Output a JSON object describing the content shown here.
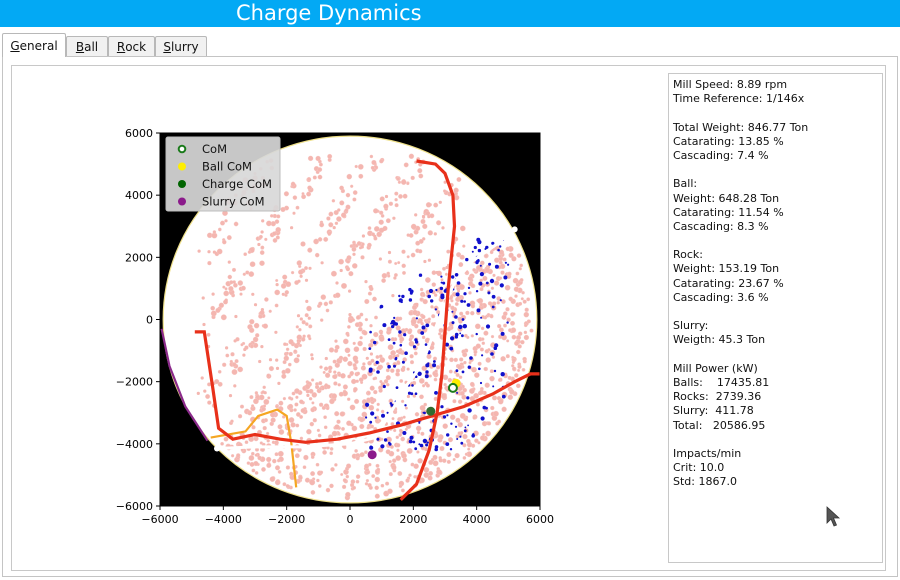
{
  "window": {
    "title": "Charge Dynamics"
  },
  "tabs": [
    {
      "label": "General",
      "accel": "G",
      "rest": "eneral",
      "active": true
    },
    {
      "label": "Ball",
      "accel": "B",
      "rest": "all",
      "active": false
    },
    {
      "label": "Rock",
      "accel": "R",
      "rest": "ock",
      "active": false
    },
    {
      "label": "Slurry",
      "accel": "S",
      "rest": "lurry",
      "active": false
    }
  ],
  "info": {
    "mill_speed": "Mill Speed: 8.89 rpm",
    "time_reference": "Time Reference: 1/146x",
    "total_weight": "Total Weight: 846.77 Ton",
    "total_catarating": "Catarating: 13.85 %",
    "total_cascading": "Cascading: 7.4 %",
    "ball_header": "Ball:",
    "ball_weight": "Weight: 648.28 Ton",
    "ball_catarating": "Catarating: 11.54 %",
    "ball_cascading": "Cascading: 8.3 %",
    "rock_header": "Rock:",
    "rock_weight": "Weight: 153.19 Ton",
    "rock_catarating": "Catarating: 23.67 %",
    "rock_cascading": "Cascading: 3.6 %",
    "slurry_header": "Slurry:",
    "slurry_weight": "Weigth: 45.3 Ton",
    "power_header": "Mill Power (kW)",
    "power_balls": "Balls:    17435.81",
    "power_rocks": "Rocks:  2739.36",
    "power_slurry": "Slurry:  411.78",
    "power_total": "Total:   20586.95",
    "impacts_header": "Impacts/min",
    "impacts_crit": "Crit: 10.0",
    "impacts_std": "Std: 1867.0"
  },
  "chart_data": {
    "type": "scatter",
    "xlim": [
      -6000,
      6000
    ],
    "ylim": [
      -6000,
      6000
    ],
    "xticks": [
      -6000,
      -4000,
      -2000,
      0,
      2000,
      4000,
      6000
    ],
    "yticks": [
      -6000,
      -4000,
      -2000,
      0,
      2000,
      4000,
      6000
    ],
    "xtick_labels": [
      "−6000",
      "−4000",
      "−2000",
      "0",
      "2000",
      "4000",
      "6000"
    ],
    "ytick_labels": [
      "−6000",
      "−4000",
      "−2000",
      "0",
      "2000",
      "4000",
      "6000"
    ],
    "legend_position": "top-left",
    "mill_radius": 5900,
    "legend": [
      {
        "label": "CoM",
        "color": "#1a7a1a",
        "marker": "ring"
      },
      {
        "label": "Ball CoM",
        "color": "#ffee00",
        "marker": "dot"
      },
      {
        "label": "Charge CoM",
        "color": "#006400",
        "marker": "dot"
      },
      {
        "label": "Slurry CoM",
        "color": "#8b1a8b",
        "marker": "dot"
      }
    ],
    "com_points": [
      {
        "name": "Ball CoM",
        "x": 3350,
        "y": -2050,
        "color": "#ffee00"
      },
      {
        "name": "CoM",
        "x": 3250,
        "y": -2200,
        "color": "#1a7a1a"
      },
      {
        "name": "Charge CoM",
        "x": 2550,
        "y": -2950,
        "color": "#2f6b2f"
      },
      {
        "name": "Slurry CoM",
        "x": 700,
        "y": -4350,
        "color": "#8b1a8b"
      }
    ],
    "colors": {
      "background": "#000000",
      "rock_particles": "#f4b6b0",
      "ball_particles": "#1010cc",
      "red_profile": "#e8301a",
      "white_profile": "#ffffff",
      "orange_profile": "#f5a623",
      "purple_profile": "#8b2a8b",
      "mill_shell": "#eee08a"
    },
    "red_profile_1": [
      [
        -4900,
        -400
      ],
      [
        -4600,
        -400
      ],
      [
        -4350,
        -2100
      ],
      [
        -4150,
        -3500
      ],
      [
        -3700,
        -3850
      ],
      [
        -3000,
        -3700
      ],
      [
        -2200,
        -3850
      ],
      [
        -1400,
        -3950
      ],
      [
        -400,
        -3850
      ],
      [
        600,
        -3650
      ],
      [
        1600,
        -3400
      ],
      [
        2600,
        -3100
      ],
      [
        3600,
        -2800
      ],
      [
        4500,
        -2400
      ],
      [
        5200,
        -2000
      ],
      [
        5700,
        -1750
      ],
      [
        6000,
        -1750
      ]
    ],
    "red_profile_2": [
      [
        1600,
        -5800
      ],
      [
        2100,
        -5300
      ],
      [
        2500,
        -4200
      ],
      [
        2750,
        -3000
      ],
      [
        2900,
        -1800
      ],
      [
        3000,
        -400
      ],
      [
        3100,
        1000
      ],
      [
        3200,
        2000
      ],
      [
        3300,
        3000
      ],
      [
        3250,
        4000
      ],
      [
        3000,
        4700
      ],
      [
        2700,
        5000
      ],
      [
        2100,
        5100
      ]
    ],
    "white_profile": [
      [
        -4200,
        -4150
      ],
      [
        -3000,
        -4100
      ],
      [
        -1500,
        -4100
      ],
      [
        0,
        -4000
      ],
      [
        800,
        -3800
      ],
      [
        1400,
        -2800
      ],
      [
        1800,
        -2100
      ],
      [
        2100,
        -1700
      ],
      [
        2400,
        -1100
      ],
      [
        2800,
        0
      ],
      [
        3300,
        1200
      ],
      [
        3900,
        1900
      ],
      [
        4600,
        2400
      ],
      [
        5200,
        2900
      ]
    ],
    "orange_profile": [
      [
        -4400,
        -3800
      ],
      [
        -3300,
        -3600
      ],
      [
        -2900,
        -3100
      ],
      [
        -2300,
        -2900
      ],
      [
        -2000,
        -3100
      ],
      [
        -1850,
        -4000
      ],
      [
        -1700,
        -5400
      ]
    ],
    "purple_profile": [
      [
        -5950,
        -300
      ],
      [
        -5700,
        -1500
      ],
      [
        -5200,
        -2800
      ],
      [
        -4500,
        -3900
      ]
    ]
  }
}
